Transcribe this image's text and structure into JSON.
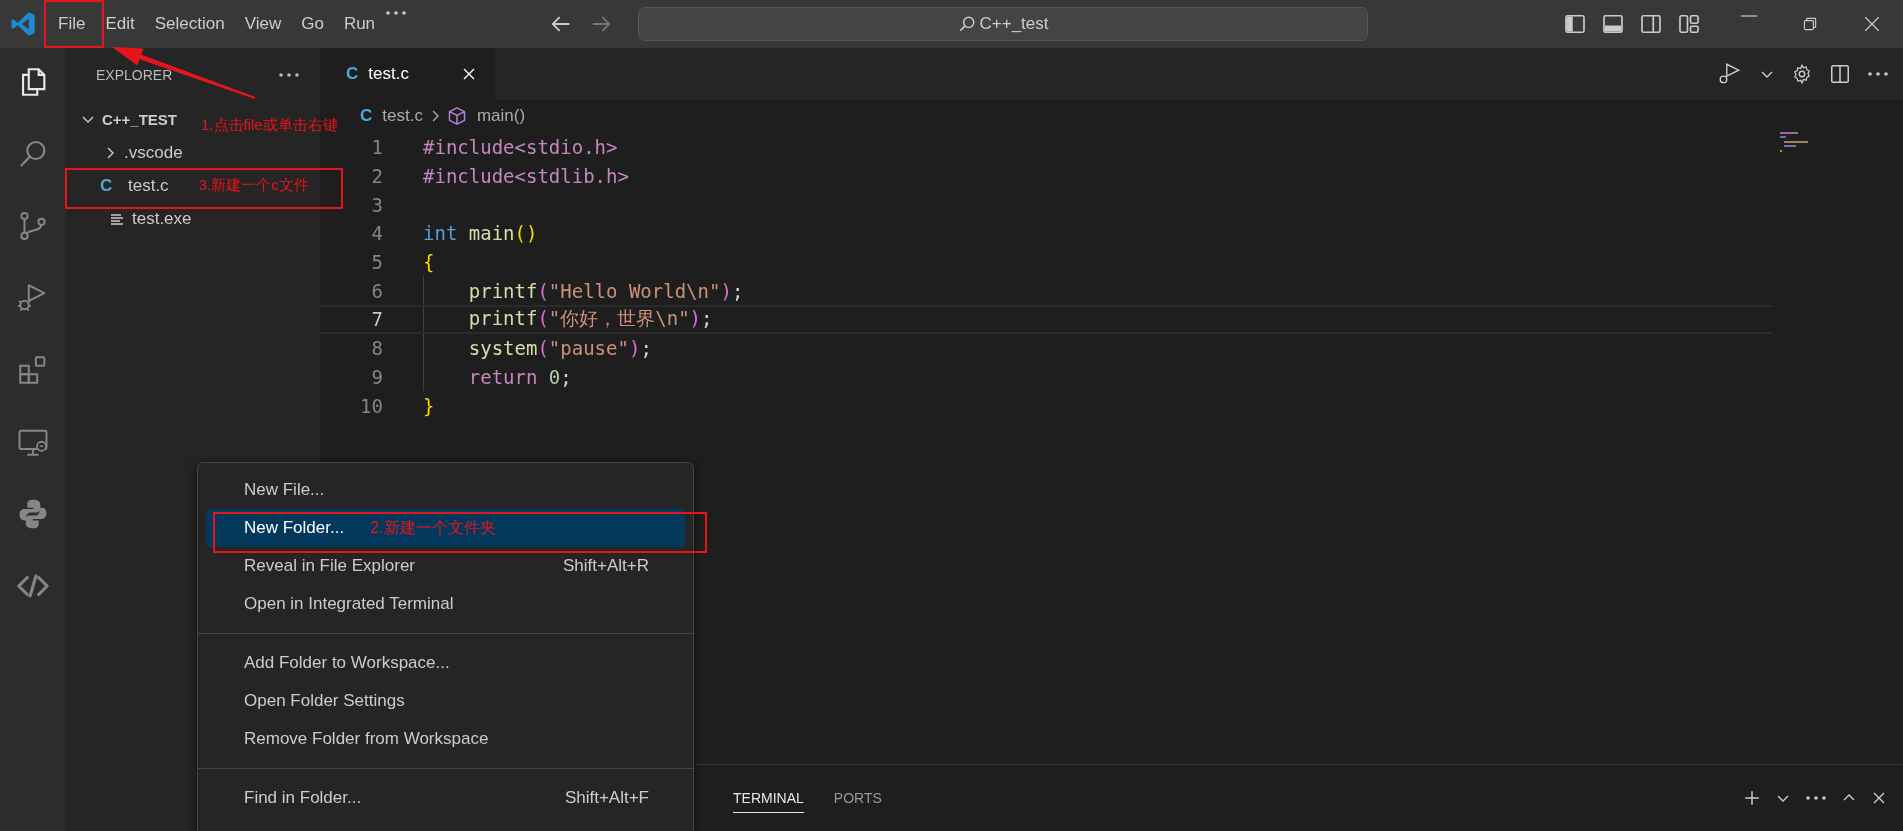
{
  "title_bar": {
    "menu": [
      {
        "label": "File",
        "annotated": true
      },
      {
        "label": "Edit",
        "annotated": false
      },
      {
        "label": "Selection",
        "annotated": false
      },
      {
        "label": "View",
        "annotated": false
      },
      {
        "label": "Go",
        "annotated": false
      },
      {
        "label": "Run",
        "annotated": false
      }
    ],
    "search": "C++_test"
  },
  "activity_bar": [
    {
      "kind": "explorer",
      "selected": true
    },
    {
      "kind": "search",
      "selected": false
    },
    {
      "kind": "source-control",
      "selected": false
    },
    {
      "kind": "run-debug",
      "selected": false
    },
    {
      "kind": "extensions",
      "selected": false
    },
    {
      "kind": "remote",
      "selected": false
    },
    {
      "kind": "python",
      "selected": false
    },
    {
      "kind": "liveshare",
      "selected": false
    }
  ],
  "sidebar": {
    "title": "EXPLORER",
    "tree": [
      {
        "label": "C++_TEST",
        "kind": "root",
        "expanded": true,
        "annotated": false,
        "note": "1.点击file或单击右键",
        "children": [
          {
            "label": ".vscode",
            "kind": "folder",
            "expanded": false,
            "annotated": false
          },
          {
            "label": "test.c",
            "kind": "c-file",
            "badge": "C",
            "annotated": true,
            "note": "3.新建一个c文件"
          },
          {
            "label": "test.exe",
            "kind": "file",
            "annotated": false
          }
        ]
      }
    ]
  },
  "editor": {
    "tabs": [
      {
        "label": "test.c",
        "badge": "C",
        "selected": true
      }
    ],
    "breadcrumb": [
      {
        "label": "test.c",
        "kind": "file",
        "badge": "C"
      },
      {
        "label": "main()",
        "kind": "function"
      }
    ],
    "lines": [
      {
        "number": "1",
        "current": false,
        "indented": false,
        "tokens": [
          {
            "kind": "directive",
            "text": "#include<stdio.h>"
          }
        ]
      },
      {
        "number": "2",
        "current": false,
        "indented": false,
        "tokens": [
          {
            "kind": "directive",
            "text": "#include<stdlib.h>"
          }
        ]
      },
      {
        "number": "3",
        "current": false,
        "indented": false
      },
      {
        "number": "4",
        "current": false,
        "indented": false,
        "tokens": [
          {
            "kind": "keyword",
            "text": "int "
          },
          {
            "kind": "function",
            "text": "main"
          },
          {
            "kind": "bracket1",
            "text": "()"
          }
        ]
      },
      {
        "number": "5",
        "current": false,
        "indented": false,
        "tokens": [
          {
            "kind": "bracket1",
            "text": "{"
          }
        ]
      },
      {
        "number": "6",
        "current": false,
        "indented": true,
        "tokens": [
          {
            "kind": "function",
            "text": "printf"
          },
          {
            "kind": "bracket2",
            "text": "("
          },
          {
            "kind": "string",
            "text": "\"Hello World\\n\""
          },
          {
            "kind": "bracket2",
            "text": ")"
          },
          {
            "kind": "plain",
            "text": ";"
          }
        ]
      },
      {
        "number": "7",
        "current": true,
        "indented": true,
        "tokens": [
          {
            "kind": "function",
            "text": "printf"
          },
          {
            "kind": "bracket2",
            "text": "("
          },
          {
            "kind": "string",
            "text": "\"你好，世界\\n\""
          },
          {
            "kind": "bracket2",
            "text": ")"
          },
          {
            "kind": "plain",
            "text": ";"
          }
        ]
      },
      {
        "number": "8",
        "current": false,
        "indented": true,
        "tokens": [
          {
            "kind": "function",
            "text": "system"
          },
          {
            "kind": "bracket2",
            "text": "("
          },
          {
            "kind": "string",
            "text": "\"pause\""
          },
          {
            "kind": "bracket2",
            "text": ")"
          },
          {
            "kind": "plain",
            "text": ";"
          }
        ]
      },
      {
        "number": "9",
        "current": false,
        "indented": true,
        "tokens": [
          {
            "kind": "control",
            "text": "return "
          },
          {
            "kind": "number",
            "text": "0"
          },
          {
            "kind": "plain",
            "text": ";"
          }
        ]
      },
      {
        "number": "10",
        "current": false,
        "indented": false,
        "tokens": [
          {
            "kind": "bracket1",
            "text": "}"
          }
        ]
      }
    ]
  },
  "context_menu": {
    "groups": [
      [
        {
          "label": "New File...",
          "selected": false,
          "annotated": false
        },
        {
          "label": "New Folder...",
          "selected": true,
          "annotated": true,
          "note": "2.新建一个文件夹"
        },
        {
          "label": "Reveal in File Explorer",
          "shortcut": "Shift+Alt+R",
          "selected": false,
          "annotated": false
        },
        {
          "label": "Open in Integrated Terminal",
          "selected": false,
          "annotated": false
        }
      ],
      [
        {
          "label": "Add Folder to Workspace...",
          "selected": false,
          "annotated": false
        },
        {
          "label": "Open Folder Settings",
          "selected": false,
          "annotated": false
        },
        {
          "label": "Remove Folder from Workspace",
          "selected": false,
          "annotated": false
        }
      ],
      [
        {
          "label": "Find in Folder...",
          "shortcut": "Shift+Alt+F",
          "selected": false,
          "annotated": false
        }
      ]
    ]
  },
  "panel": {
    "tabs": [
      {
        "label": "TERMINAL",
        "selected": true
      },
      {
        "label": "PORTS",
        "selected": false
      }
    ]
  }
}
